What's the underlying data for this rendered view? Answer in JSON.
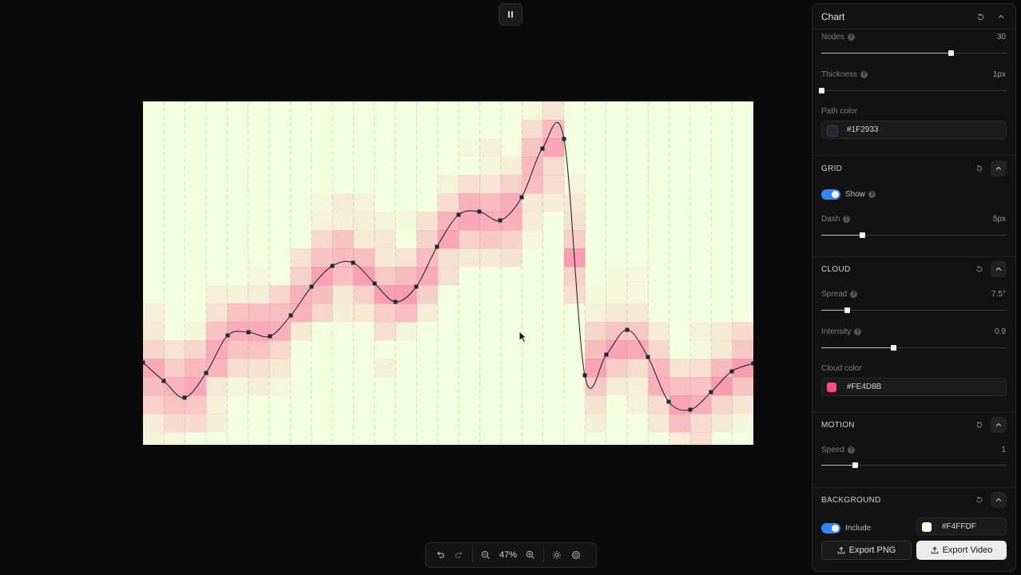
{
  "toolbar": {
    "zoom": "47%",
    "icons": [
      "undo-icon",
      "redo-icon",
      "zoom-out-icon",
      "zoom-in-icon",
      "sun-icon",
      "target-icon"
    ]
  },
  "canvas": {
    "background": "#F4FFDF",
    "path_color": "#1F2933",
    "cloud_color": "#FE4D8B"
  },
  "panel": {
    "title": "Chart",
    "nodes": {
      "label": "Nodes",
      "value": "30",
      "level": 0.7
    },
    "thickness": {
      "label": "Thickness",
      "value": "1px",
      "level": 0.0
    },
    "path_color": {
      "label": "Path color",
      "value": "#1F2933"
    },
    "grid": {
      "title": "GRID",
      "show_label": "Show",
      "show_on": true,
      "dash": {
        "label": "Dash",
        "value": "5px",
        "level": 0.22
      }
    },
    "cloud": {
      "title": "CLOUD",
      "spread": {
        "label": "Spread",
        "value": "7.5°",
        "level": 0.14
      },
      "intensity": {
        "label": "Intensity",
        "value": "0.9",
        "level": 0.39
      },
      "cloud_color": {
        "label": "Cloud color",
        "value": "#FE4D8B"
      }
    },
    "motion": {
      "title": "MOTION",
      "speed": {
        "label": "Speed",
        "value": "1",
        "level": 0.18
      }
    },
    "background": {
      "title": "BACKGROUND",
      "include_label": "Include",
      "include_on": true,
      "color": "#F4FFDF"
    },
    "export_png": "Export PNG",
    "export_video": "Export Video"
  }
}
